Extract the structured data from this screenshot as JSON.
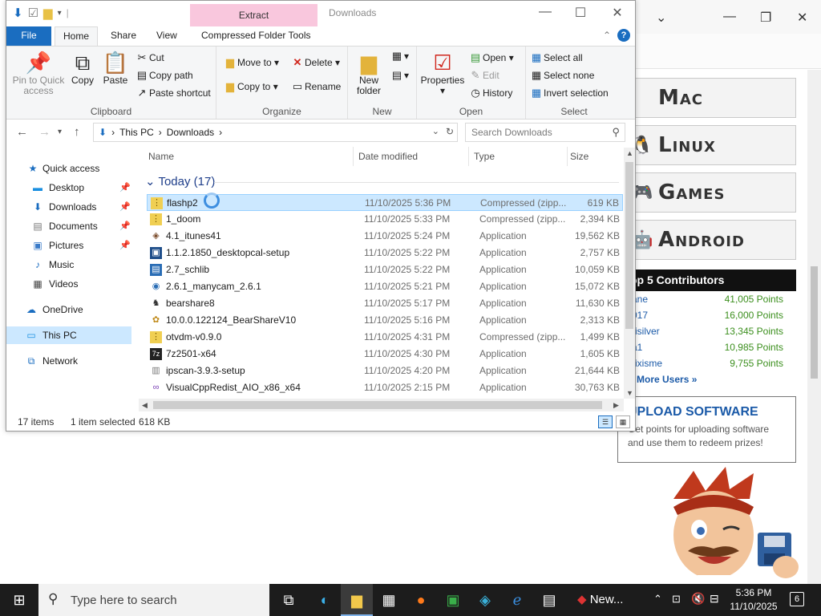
{
  "browser": {
    "win_minimize": "—",
    "win_restore": "❐",
    "win_close": "✕",
    "dropdown": "⌄",
    "platforms": [
      {
        "label": "Mac",
        "icon": "apple-icon"
      },
      {
        "label": "Linux",
        "icon": "tux-icon"
      },
      {
        "label": "Games",
        "icon": "gamepad-icon"
      },
      {
        "label": "Android",
        "icon": "android-icon"
      }
    ],
    "contributors": {
      "title": "op 5 Contributors",
      "rows": [
        {
          "name": "ane",
          "points": "41,005 Points"
        },
        {
          "name": "017",
          "points": "16,000 Points"
        },
        {
          "name": "risilver",
          "points": "13,345 Points"
        },
        {
          "name": "a1",
          "points": "10,985 Points"
        },
        {
          "name": "rixisme",
          "points": "9,755 Points"
        }
      ],
      "more": "More Users »"
    },
    "upload": {
      "title": "UPLOAD SOFTWARE",
      "text": "Get points for uploading software and use them to redeem prizes!"
    }
  },
  "explorer": {
    "extract_tab": "Extract",
    "title": "Downloads",
    "ribbon_tabs": {
      "file": "File",
      "home": "Home",
      "share": "Share",
      "view": "View",
      "compressed": "Compressed Folder Tools"
    },
    "clipboard": {
      "pin": "Pin to Quick access",
      "copy": "Copy",
      "paste": "Paste",
      "cut": "Cut",
      "copy_path": "Copy path",
      "paste_shortcut": "Paste shortcut",
      "label": "Clipboard"
    },
    "organize": {
      "move_to": "Move to",
      "copy_to": "Copy to",
      "delete": "Delete",
      "rename": "Rename",
      "label": "Organize"
    },
    "new": {
      "new_folder": "New folder",
      "label": "New"
    },
    "open": {
      "properties": "Properties",
      "open": "Open",
      "edit": "Edit",
      "history": "History",
      "label": "Open"
    },
    "select": {
      "select_all": "Select all",
      "select_none": "Select none",
      "invert": "Invert selection",
      "label": "Select"
    },
    "address": {
      "this_pc": "This PC",
      "downloads": "Downloads",
      "sep": "›"
    },
    "search": {
      "placeholder": "Search Downloads"
    },
    "nav": {
      "quick_access": "Quick access",
      "desktop": "Desktop",
      "downloads": "Downloads",
      "documents": "Documents",
      "pictures": "Pictures",
      "music": "Music",
      "videos": "Videos",
      "onedrive": "OneDrive",
      "this_pc": "This PC",
      "network": "Network"
    },
    "columns": {
      "name": "Name",
      "date": "Date modified",
      "type": "Type",
      "size": "Size"
    },
    "group": "Today (17)",
    "files": [
      {
        "name": "flashp2",
        "date": "11/10/2025 5:36 PM",
        "type": "Compressed (zipp...",
        "size": "619 KB"
      },
      {
        "name": "1_doom",
        "date": "11/10/2025 5:33 PM",
        "type": "Compressed (zipp...",
        "size": "2,394 KB"
      },
      {
        "name": "4.1_itunes41",
        "date": "11/10/2025 5:24 PM",
        "type": "Application",
        "size": "19,562 KB"
      },
      {
        "name": "1.1.2.1850_desktopcal-setup",
        "date": "11/10/2025 5:22 PM",
        "type": "Application",
        "size": "2,757 KB"
      },
      {
        "name": "2.7_schlib",
        "date": "11/10/2025 5:22 PM",
        "type": "Application",
        "size": "10,059 KB"
      },
      {
        "name": "2.6.1_manycam_2.6.1",
        "date": "11/10/2025 5:21 PM",
        "type": "Application",
        "size": "15,072 KB"
      },
      {
        "name": "bearshare8",
        "date": "11/10/2025 5:17 PM",
        "type": "Application",
        "size": "11,630 KB"
      },
      {
        "name": "10.0.0.122124_BearShareV10",
        "date": "11/10/2025 5:16 PM",
        "type": "Application",
        "size": "2,313 KB"
      },
      {
        "name": "otvdm-v0.9.0",
        "date": "11/10/2025 4:31 PM",
        "type": "Compressed (zipp...",
        "size": "1,499 KB"
      },
      {
        "name": "7z2501-x64",
        "date": "11/10/2025 4:30 PM",
        "type": "Application",
        "size": "1,605 KB"
      },
      {
        "name": "ipscan-3.9.3-setup",
        "date": "11/10/2025 4:20 PM",
        "type": "Application",
        "size": "21,644 KB"
      },
      {
        "name": "VisualCppRedist_AIO_x86_x64",
        "date": "11/10/2025 2:15 PM",
        "type": "Application",
        "size": "30,763 KB"
      }
    ],
    "status": {
      "count": "17 items",
      "selected": "1 item selected",
      "size": "618 KB"
    }
  },
  "taskbar": {
    "search_placeholder": "Type here to search",
    "news": "New...",
    "time": "5:36 PM",
    "date": "11/10/2025",
    "notifications": "6"
  },
  "colors": {
    "accent": "#1a6dc0",
    "selection": "#cce8ff",
    "extract_tab": "#f9c7dd",
    "link": "#1b5aa8",
    "points": "#3c8f1e"
  }
}
